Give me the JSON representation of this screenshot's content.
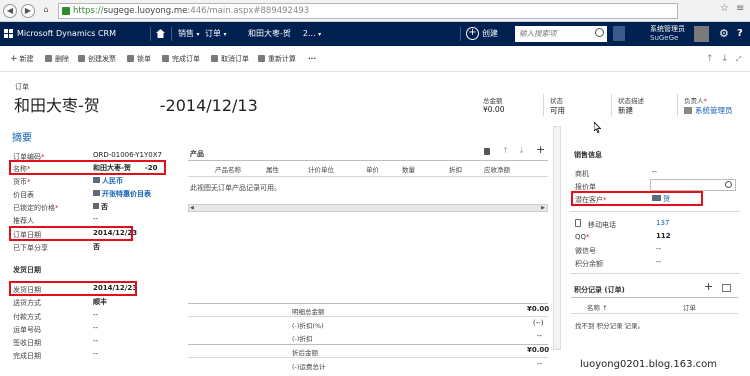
{
  "browser": {
    "url_scheme": "https://",
    "url_host": "sugege.luoyong.me",
    "url_rest": ":446/main.aspx#889492493"
  },
  "nav": {
    "app_name": "Microsoft Dynamics CRM",
    "area": "销售",
    "entity": "订单",
    "record": "和田大枣-贺",
    "record_suffix": "2...",
    "create": "创建",
    "search_placeholder": "输入搜索项",
    "user_name": "系统管理员",
    "org_name": "SuGeGe"
  },
  "command_bar": {
    "new": "新建",
    "delete": "删除",
    "create_invoice": "创建发票",
    "lock_price": "锁单",
    "fulfill": "完成订单",
    "cancel": "取消订单",
    "recalculate": "重新计算",
    "more": "···"
  },
  "header": {
    "entity_label": "订单",
    "title_part1": "和田大枣-贺",
    "title_part2": "-2014/12/13",
    "total_label": "总金额",
    "total_value": "¥0.00",
    "status_label": "状态",
    "status_value": "可用",
    "status_reason_label": "状态描述",
    "status_reason_value": "新建",
    "owner_label": "负责人",
    "owner_required": "*",
    "owner_value": "系统管理员"
  },
  "summary": {
    "section_title": "摘要",
    "fields": [
      {
        "label": "订单编码",
        "required": "*",
        "value": "ORD-01006-Y1Y0X7"
      },
      {
        "label": "名称",
        "required": "*",
        "value": "和田大枣-贺",
        "value_suffix": "-20"
      },
      {
        "label": "货币",
        "required": "*",
        "value": "人民币"
      },
      {
        "label": "价目表",
        "required": "",
        "value": "开张特惠价目表"
      },
      {
        "label": "已锁定的价格",
        "required": "*",
        "value": "否"
      },
      {
        "label": "推荐人",
        "required": "",
        "value": "--"
      },
      {
        "label": "订单日期",
        "required": "",
        "value": "2014/12/23"
      },
      {
        "label": "已下单分享",
        "required": "",
        "value": "否"
      }
    ]
  },
  "shipping": {
    "section_title": "发货日期",
    "fields": [
      {
        "label": "发货日期",
        "value": "2014/12/23"
      },
      {
        "label": "送货方式",
        "value": "顺丰"
      },
      {
        "label": "付款方式",
        "value": "--"
      },
      {
        "label": "运单号码",
        "value": "--"
      },
      {
        "label": "签收日期",
        "value": "--"
      },
      {
        "label": "完成日期",
        "value": "--"
      }
    ]
  },
  "products": {
    "title": "产品",
    "columns": [
      "产品名称",
      "属性",
      "计价单位",
      "单价",
      "数量",
      "折扣",
      "应收净额"
    ],
    "empty_text": "此视图无订单产品记录可用。"
  },
  "totals": [
    {
      "label": "明细总金额",
      "value": "¥0.00"
    },
    {
      "label": "(-)折扣(%)",
      "value": "(--)"
    },
    {
      "label": "(-)折扣",
      "value": "--"
    },
    {
      "label": "折后金额",
      "value": "¥0.00"
    },
    {
      "label": "(-)运费总计",
      "value": "--"
    }
  ],
  "sales_info": {
    "section_title": "销售信息",
    "opportunity_label": "商机",
    "opportunity_value": "--",
    "quote_label": "报价单",
    "customer_label": "潜在客户",
    "customer_required": "*",
    "customer_value": "贺"
  },
  "contact": {
    "phone_label": "移动电话",
    "phone_value": "137",
    "qq_label": "QQ",
    "qq_required": "*",
    "qq_value": "112",
    "wechat_label": "微信号",
    "wechat_value": "--",
    "points_label": "积分余额",
    "points_value": "--"
  },
  "points_records": {
    "title": "积分记录 (订单)",
    "col_name": "名称",
    "col_sort": "↑",
    "col_order": "订单",
    "empty_text": "找不到 积分记录 记录。"
  },
  "watermark": "luoyong0201.blog.163.com"
}
